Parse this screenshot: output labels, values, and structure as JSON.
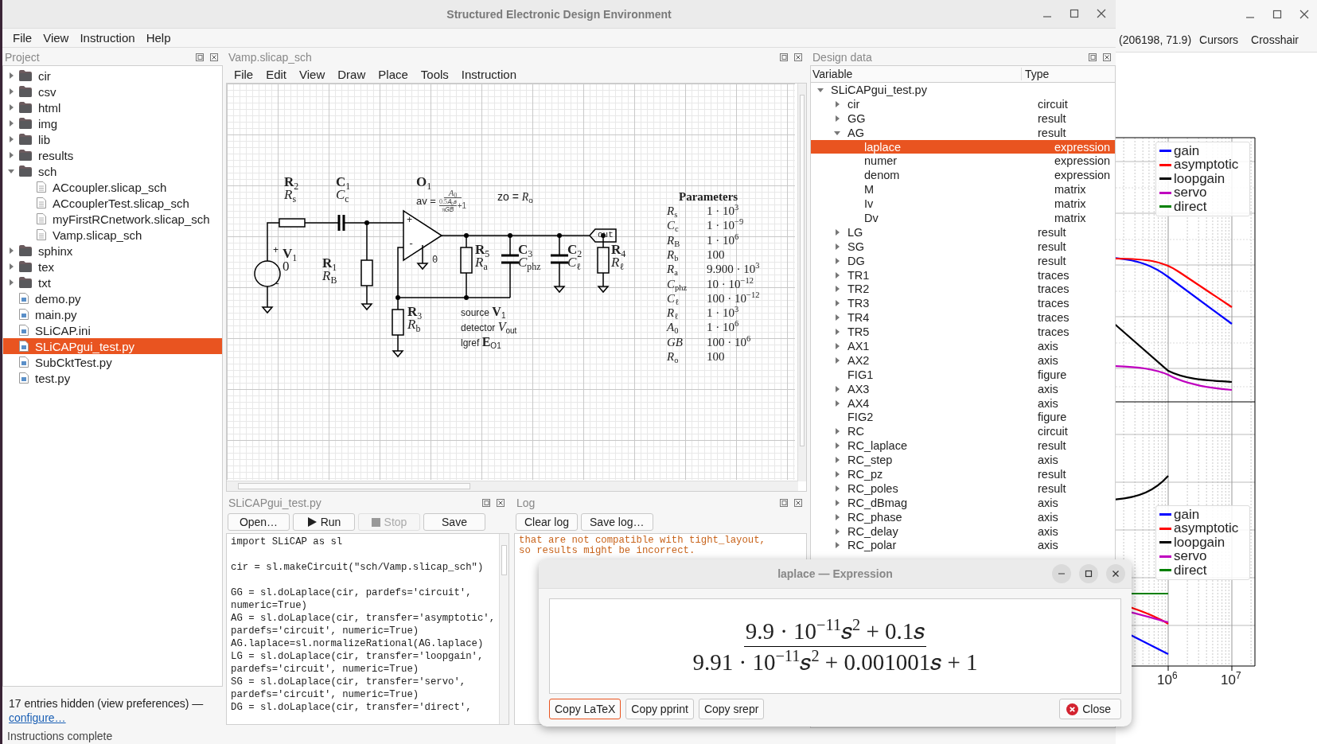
{
  "window": {
    "title": "Structured Electronic Design Environment"
  },
  "menu": [
    "File",
    "View",
    "Instruction",
    "Help"
  ],
  "project": {
    "title": "Project",
    "items": [
      {
        "name": "cir",
        "kind": "folder",
        "expanded": false,
        "selected": false
      },
      {
        "name": "csv",
        "kind": "folder",
        "expanded": false,
        "selected": false
      },
      {
        "name": "html",
        "kind": "folder",
        "expanded": false,
        "selected": false
      },
      {
        "name": "img",
        "kind": "folder",
        "expanded": false,
        "selected": false
      },
      {
        "name": "lib",
        "kind": "folder",
        "expanded": false,
        "selected": false
      },
      {
        "name": "results",
        "kind": "folder",
        "expanded": false,
        "selected": false
      },
      {
        "name": "sch",
        "kind": "folder",
        "expanded": true,
        "selected": false,
        "children": [
          {
            "name": "ACcoupler.slicap_sch",
            "kind": "file",
            "selected": false
          },
          {
            "name": "ACcouplerTest.slicap_sch",
            "kind": "file",
            "selected": false
          },
          {
            "name": "myFirstRCnetwork.slicap_sch",
            "kind": "file",
            "selected": false
          },
          {
            "name": "Vamp.slicap_sch",
            "kind": "file",
            "selected": false
          }
        ]
      },
      {
        "name": "sphinx",
        "kind": "folder",
        "expanded": false,
        "selected": false
      },
      {
        "name": "tex",
        "kind": "folder",
        "expanded": false,
        "selected": false
      },
      {
        "name": "txt",
        "kind": "folder",
        "expanded": false,
        "selected": false
      },
      {
        "name": "demo.py",
        "kind": "script",
        "selected": false
      },
      {
        "name": "main.py",
        "kind": "script",
        "selected": false
      },
      {
        "name": "SLiCAP.ini",
        "kind": "script",
        "selected": false
      },
      {
        "name": "SLiCAPgui_test.py",
        "kind": "script",
        "selected": true
      },
      {
        "name": "SubCktTest.py",
        "kind": "script",
        "selected": false
      },
      {
        "name": "test.py",
        "kind": "script",
        "selected": false
      }
    ],
    "hidden_note": "17 entries hidden (view preferences) —",
    "link": "configure…"
  },
  "schematic": {
    "title": "Vamp.slicap_sch",
    "menu": [
      "File",
      "Edit",
      "View",
      "Draw",
      "Place",
      "Tools",
      "Instruction"
    ],
    "components": [
      {
        "designator": "**R**$_{2}$",
        "value": "*R*$_{s}$"
      },
      {
        "designator": "**C**$_{1}$",
        "value": "*C*$_{c}$"
      },
      {
        "designator": "**V**$_{1}$",
        "value": "0"
      },
      {
        "designator": "**R**$_{1}$",
        "value": "*R*$_{B}$"
      },
      {
        "designator": "**R**$_{5}$",
        "value": "*R*$_{a}$"
      },
      {
        "designator": "**C**$_{3}$",
        "value": "*C*$_{phz}$"
      },
      {
        "designator": "**C**$_{2}$",
        "value": "*C*$_{ℓ}$"
      },
      {
        "designator": "**R**$_{4}$",
        "value": "*R*$_{ℓ}$"
      },
      {
        "designator": "**R**$_{3}$",
        "value": "*R*$_{b}$"
      }
    ],
    "marks": [
      "+",
      "-",
      "+",
      "-",
      "0"
    ],
    "opamp": {
      "designator": "**O**$_{1}$",
      "av_label": "av =",
      "av_numerator": "*A*$_{0}$",
      "av_inner_numerator": "0.5𝐴$_{0}$𝑠",
      "av_inner_denominator": "π𝐺𝐵",
      "av_tail": "+1",
      "zo": "zo = *R*$_{o}$"
    },
    "out_label": "out",
    "instructions": [
      "source **V**$_{1}$",
      "detector *V*$_{out}$",
      "lgref **E**$_{O1}$"
    ],
    "parameters_title": "Parameters",
    "parameters": [
      {
        "name": "*R*$_{s}$",
        "value": "1 · 10$^{3}$"
      },
      {
        "name": "*C*$_{c}$",
        "value": "1 · 10$^{−9}$"
      },
      {
        "name": "*R*$_{B}$",
        "value": "1 · 10$^{6}$"
      },
      {
        "name": "*R*$_{b}$",
        "value": "100"
      },
      {
        "name": "*R*$_{a}$",
        "value": "9.900 · 10$^{3}$"
      },
      {
        "name": "*C*$_{phz}$",
        "value": "10 · 10$^{−12}$"
      },
      {
        "name": "*C*$_{ℓ}$",
        "value": "100 · 10$^{−12}$"
      },
      {
        "name": "*R*$_{ℓ}$",
        "value": "1 · 10$^{3}$"
      },
      {
        "name": "*A*$_{0}$",
        "value": "1 · 10$^{6}$"
      },
      {
        "name": "*GB*",
        "value": "100 · 10$^{6}$"
      },
      {
        "name": "*R*$_{o}$",
        "value": "100"
      }
    ]
  },
  "editor": {
    "title": "SLiCAPgui_test.py",
    "buttons": [
      {
        "label": "Open…",
        "kind": "plain",
        "disabled": false
      },
      {
        "label": "Run",
        "kind": "run",
        "disabled": false
      },
      {
        "label": "Stop",
        "kind": "stop",
        "disabled": true
      },
      {
        "label": "Save",
        "kind": "plain",
        "disabled": false
      }
    ],
    "lines": [
      {
        "kind": "code",
        "text": "import SLiCAP as sl"
      },
      {
        "kind": "blank"
      },
      {
        "kind": "code",
        "text": "cir = sl.makeCircuit(\"sch/Vamp.slicap_sch\")"
      },
      {
        "kind": "blank"
      },
      {
        "kind": "code",
        "text": "GG = sl.doLaplace(cir, pardefs='circuit',"
      },
      {
        "kind": "code",
        "text": "numeric=True)"
      },
      {
        "kind": "code",
        "text": "AG = sl.doLaplace(cir, transfer='asymptotic',"
      },
      {
        "kind": "code",
        "text": "pardefs='circuit', numeric=True)"
      },
      {
        "kind": "code",
        "text": "AG.laplace=sl.normalizeRational(AG.laplace)"
      },
      {
        "kind": "code",
        "text": "LG = sl.doLaplace(cir, transfer='loopgain',"
      },
      {
        "kind": "code",
        "text": "pardefs='circuit', numeric=True)"
      },
      {
        "kind": "code",
        "text": "SG = sl.doLaplace(cir, transfer='servo',"
      },
      {
        "kind": "code",
        "text": "pardefs='circuit', numeric=True)"
      },
      {
        "kind": "code",
        "text": "DG = sl.doLaplace(cir, transfer='direct',"
      }
    ]
  },
  "log": {
    "title": "Log",
    "buttons": [
      "Clear log",
      "Save log…"
    ],
    "lines": [
      "that are not compatible with tight_layout,",
      "so results might be incorrect."
    ]
  },
  "design_data": {
    "title": "Design data",
    "columns": [
      "Variable",
      "Type"
    ],
    "items": [
      {
        "name": "SLiCAPgui_test.py",
        "expanded": true,
        "selected": false,
        "children": [
          {
            "name": "cir",
            "type": "circuit",
            "expanded": false,
            "selected": false
          },
          {
            "name": "GG",
            "type": "result",
            "expanded": false,
            "selected": false
          },
          {
            "name": "AG",
            "type": "result",
            "expanded": true,
            "selected": false,
            "children": [
              {
                "name": "laplace",
                "type": "expression",
                "selected": true
              },
              {
                "name": "numer",
                "type": "expression",
                "selected": false
              },
              {
                "name": "denom",
                "type": "expression",
                "selected": false
              },
              {
                "name": "M",
                "type": "matrix",
                "selected": false
              },
              {
                "name": "Iv",
                "type": "matrix",
                "selected": false
              },
              {
                "name": "Dv",
                "type": "matrix",
                "selected": false
              }
            ]
          },
          {
            "name": "LG",
            "type": "result",
            "expanded": false,
            "selected": false
          },
          {
            "name": "SG",
            "type": "result",
            "expanded": false,
            "selected": false
          },
          {
            "name": "DG",
            "type": "result",
            "expanded": false,
            "selected": false
          },
          {
            "name": "TR1",
            "type": "traces",
            "expanded": false,
            "selected": false
          },
          {
            "name": "TR2",
            "type": "traces",
            "expanded": false,
            "selected": false
          },
          {
            "name": "TR3",
            "type": "traces",
            "expanded": false,
            "selected": false
          },
          {
            "name": "TR4",
            "type": "traces",
            "expanded": false,
            "selected": false
          },
          {
            "name": "TR5",
            "type": "traces",
            "expanded": false,
            "selected": false
          },
          {
            "name": "AX1",
            "type": "axis",
            "expanded": false,
            "selected": false
          },
          {
            "name": "AX2",
            "type": "axis",
            "expanded": false,
            "selected": false
          },
          {
            "name": "FIG1",
            "type": "figure",
            "selected": false
          },
          {
            "name": "AX3",
            "type": "axis",
            "expanded": false,
            "selected": false
          },
          {
            "name": "AX4",
            "type": "axis",
            "expanded": false,
            "selected": false
          },
          {
            "name": "FIG2",
            "type": "figure",
            "selected": false
          },
          {
            "name": "RC",
            "type": "circuit",
            "expanded": false,
            "selected": false
          },
          {
            "name": "RC_laplace",
            "type": "result",
            "expanded": false,
            "selected": false
          },
          {
            "name": "RC_step",
            "type": "axis",
            "expanded": false,
            "selected": false
          },
          {
            "name": "RC_pz",
            "type": "result",
            "expanded": false,
            "selected": false
          },
          {
            "name": "RC_poles",
            "type": "result",
            "expanded": false,
            "selected": false
          },
          {
            "name": "RC_dBmag",
            "type": "axis",
            "expanded": false,
            "selected": false
          },
          {
            "name": "RC_phase",
            "type": "axis",
            "expanded": false,
            "selected": false
          },
          {
            "name": "RC_delay",
            "type": "axis",
            "expanded": false,
            "selected": false
          },
          {
            "name": "RC_polar",
            "type": "axis",
            "expanded": false,
            "selected": false
          }
        ]
      }
    ]
  },
  "status_bar": "Instructions complete",
  "plot_window": {
    "readout": "(206198, 71.9)",
    "buttons": [
      "Cursors",
      "Crosshair"
    ],
    "legends": [
      [
        {
          "label": "gain",
          "color": "#0000ff"
        },
        {
          "label": "asymptotic",
          "color": "#ff0000"
        },
        {
          "label": "loopgain",
          "color": "#000000"
        },
        {
          "label": "servo",
          "color": "#bf00bf"
        },
        {
          "label": "direct",
          "color": "#008000"
        }
      ],
      [
        {
          "label": "gain",
          "color": "#0000ff"
        },
        {
          "label": "asymptotic",
          "color": "#ff0000"
        },
        {
          "label": "loopgain",
          "color": "#000000"
        },
        {
          "label": "servo",
          "color": "#bf00bf"
        },
        {
          "label": "direct",
          "color": "#008000"
        }
      ]
    ],
    "tick_labels": [
      "10$^{6}$",
      "10$^{7}$"
    ]
  },
  "dialog": {
    "title": "laplace — Expression",
    "numerator": "9.9 · 10$^{−11}$𝑠$^{2}$ + 0.1𝑠",
    "denominator": "9.91 · 10$^{−11}$𝑠$^{2}$ + 0.001001𝑠 + 1",
    "buttons": [
      {
        "label": "Copy LaTeX",
        "selected": true
      },
      {
        "label": "Copy pprint",
        "selected": false
      },
      {
        "label": "Copy srepr",
        "selected": false
      }
    ],
    "close": "Close"
  }
}
